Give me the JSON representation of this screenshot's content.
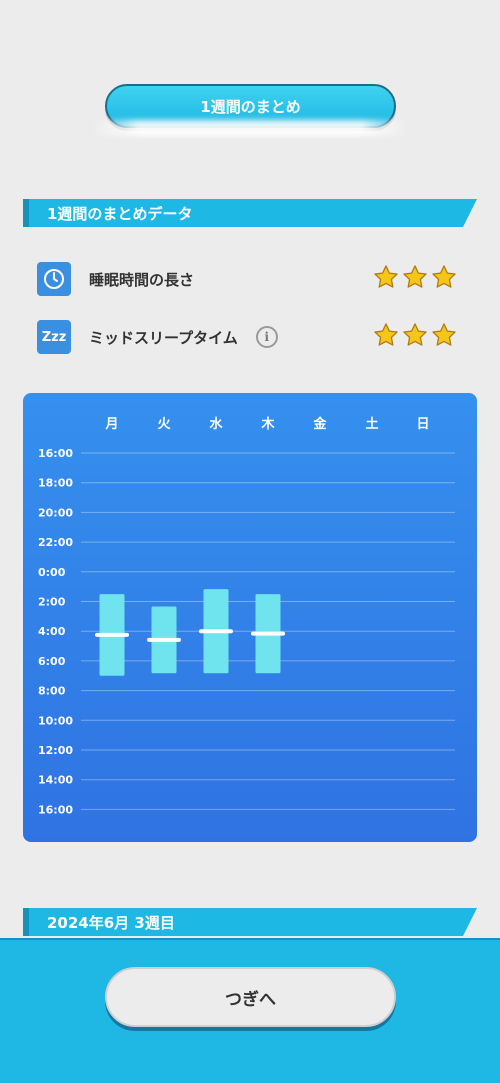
{
  "header": {
    "title": "1週間のまとめ"
  },
  "section1": {
    "label": "1週間のまとめデータ"
  },
  "metrics": [
    {
      "label": "睡眠時間の長さ",
      "icon": "clock-icon",
      "stars": 3
    },
    {
      "label": "ミッドスリープタイム",
      "icon": "zzz-icon",
      "icon_text": "Zzz",
      "stars": 3,
      "has_info": true
    }
  ],
  "info_glyph": "i",
  "chart_data": {
    "type": "range-bar",
    "categories": [
      "月",
      "火",
      "水",
      "木",
      "金",
      "土",
      "日"
    ],
    "y_tick_labels": [
      "16:00",
      "18:00",
      "20:00",
      "22:00",
      "0:00",
      "2:00",
      "4:00",
      "6:00",
      "8:00",
      "10:00",
      "12:00",
      "14:00",
      "16:00"
    ],
    "y_range_hours_from_16": [
      0,
      24
    ],
    "series": [
      {
        "values": [
          {
            "day": "月",
            "start": "1:30",
            "end": "7:00",
            "mid": "4:15"
          },
          {
            "day": "火",
            "start": "2:20",
            "end": "6:50",
            "mid": "4:35"
          },
          {
            "day": "水",
            "start": "1:10",
            "end": "6:50",
            "mid": "4:00"
          },
          {
            "day": "木",
            "start": "1:30",
            "end": "6:50",
            "mid": "4:10"
          },
          {
            "day": "金",
            "start": null,
            "end": null,
            "mid": null
          },
          {
            "day": "土",
            "start": null,
            "end": null,
            "mid": null
          },
          {
            "day": "日",
            "start": null,
            "end": null,
            "mid": null
          }
        ]
      }
    ],
    "grid": true
  },
  "section2": {
    "label": "2024年6月 3週目"
  },
  "footer": {
    "next_label": "つぎへ"
  },
  "colors": {
    "accent": "#1eb8e4",
    "chart_bg": "#3590ee",
    "bar": "#6fe3ee",
    "mid_marker": "#ffffff",
    "star": "#f5c518"
  }
}
